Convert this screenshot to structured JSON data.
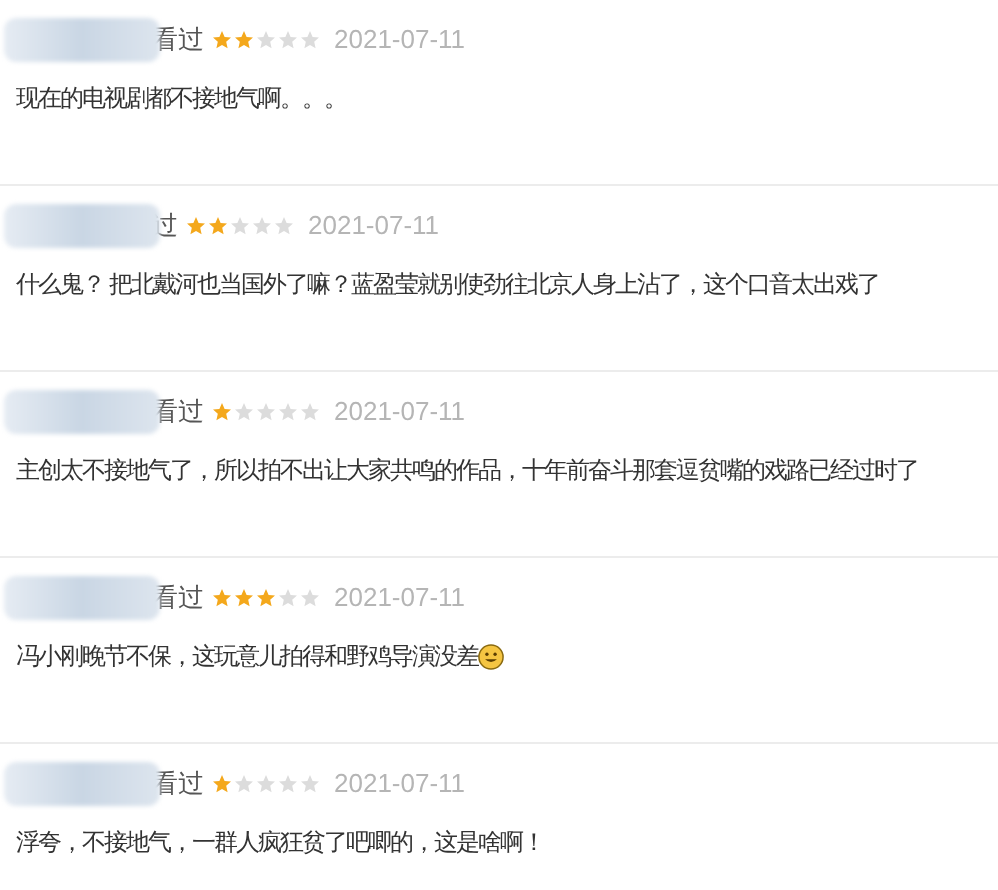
{
  "comments": [
    {
      "status": "看过",
      "stars": 2,
      "date": "2021-07-11",
      "text": "现在的电视剧都不接地气啊。。。"
    },
    {
      "status": "过",
      "stars": 2,
      "date": "2021-07-11",
      "text": "什么鬼？ 把北戴河也当国外了嘛？蓝盈莹就别使劲往北京人身上沾了，这个口音太出戏了"
    },
    {
      "status": "看过",
      "stars": 1,
      "date": "2021-07-11",
      "text": "主创太不接地气了，所以拍不出让大家共鸣的作品，十年前奋斗那套逗贫嘴的戏路已经过时了"
    },
    {
      "status": "看过",
      "stars": 3,
      "date": "2021-07-11",
      "text": "冯小刚晚节不保，这玩意儿拍得和野鸡导演没差",
      "emoji": true
    },
    {
      "status": "看过",
      "stars": 1,
      "date": "2021-07-11",
      "text": "浮夸，不接地气，一群人疯狂贫了吧唧的，这是啥啊！"
    }
  ]
}
